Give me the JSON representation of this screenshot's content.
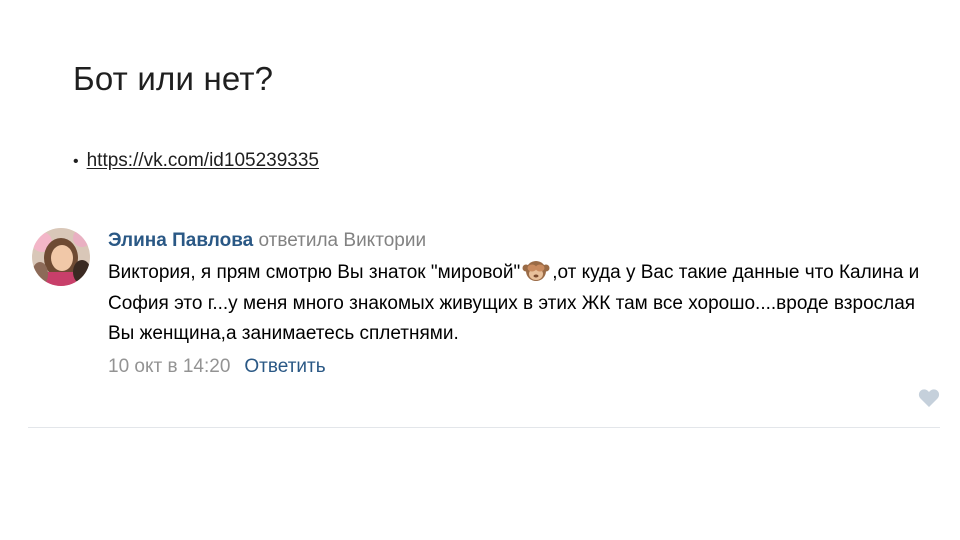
{
  "slide": {
    "title": "Бот или нет?",
    "bullet_symbol": "•",
    "link_text": "https://vk.com/id105239335"
  },
  "comment": {
    "author": "Элина Павлова",
    "reply_to": "ответила Виктории",
    "text_before_emoji": "Виктория, я прям смотрю Вы знаток \"мировой\"",
    "emoji": "see-no-evil-monkey-icon",
    "text_after_emoji": ",от куда у Вас такие данные что Калина и София это г...у меня много знакомых живущих в этих ЖК там все хорошо....вроде взрослая Вы женщина,а занимаетесь сплетнями.",
    "date": "10 окт в 14:20",
    "reply_label": "Ответить",
    "like_icon": "heart-icon"
  },
  "colors": {
    "author": "#2a5885",
    "meta": "#828282",
    "like": "#c5d0db",
    "divider": "#e3e6ea"
  }
}
